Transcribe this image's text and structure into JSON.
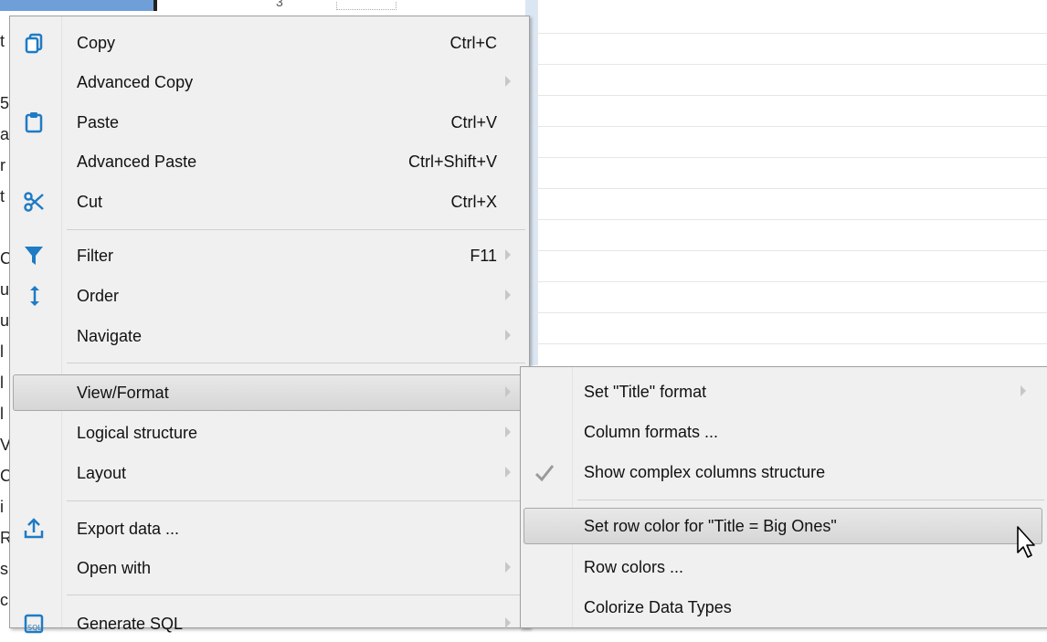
{
  "background": {
    "header_number": "3",
    "left_chars": [
      "t",
      "",
      "5",
      "a",
      "r",
      "t",
      "",
      "C",
      "u",
      "u",
      "l",
      "l",
      "l",
      "V",
      "C",
      "i",
      "R",
      "s",
      "c"
    ]
  },
  "context_menu": {
    "items": [
      {
        "label": "Copy",
        "shortcut": "Ctrl+C",
        "icon": "copy-icon"
      },
      {
        "label": "Advanced Copy",
        "shortcut": "",
        "icon": "",
        "submenu": true
      },
      {
        "label": "Paste",
        "shortcut": "Ctrl+V",
        "icon": "paste-icon"
      },
      {
        "label": "Advanced Paste",
        "shortcut": "Ctrl+Shift+V",
        "icon": ""
      },
      {
        "label": "Cut",
        "shortcut": "Ctrl+X",
        "icon": "cut-icon"
      },
      {
        "label": "Filter",
        "shortcut": "F11",
        "icon": "filter-icon",
        "submenu": true
      },
      {
        "label": "Order",
        "shortcut": "",
        "icon": "sort-icon",
        "submenu": true
      },
      {
        "label": "Navigate",
        "shortcut": "",
        "icon": "",
        "submenu": true
      },
      {
        "label": "View/Format",
        "shortcut": "",
        "icon": "",
        "submenu": true
      },
      {
        "label": "Logical structure",
        "shortcut": "",
        "icon": "",
        "submenu": true
      },
      {
        "label": "Layout",
        "shortcut": "",
        "icon": "",
        "submenu": true
      },
      {
        "label": "Export data ...",
        "shortcut": "",
        "icon": "export-icon"
      },
      {
        "label": "Open with",
        "shortcut": "",
        "icon": "",
        "submenu": true
      },
      {
        "label": "Generate SQL",
        "shortcut": "",
        "icon": "sql-icon",
        "submenu": true
      }
    ]
  },
  "submenu": {
    "items": [
      {
        "label": "Set \"Title\" format",
        "submenu": true
      },
      {
        "label": "Column formats ..."
      },
      {
        "label": "Show complex columns structure",
        "checked": true
      },
      {
        "label": "Set row color for \"Title = Big Ones\""
      },
      {
        "label": "Row colors ..."
      },
      {
        "label": "Colorize Data Types"
      }
    ]
  },
  "colors": {
    "menu_bg": "#f0f0f0",
    "icon_blue": "#1e7bc4",
    "highlight": "#d9d9d9"
  }
}
